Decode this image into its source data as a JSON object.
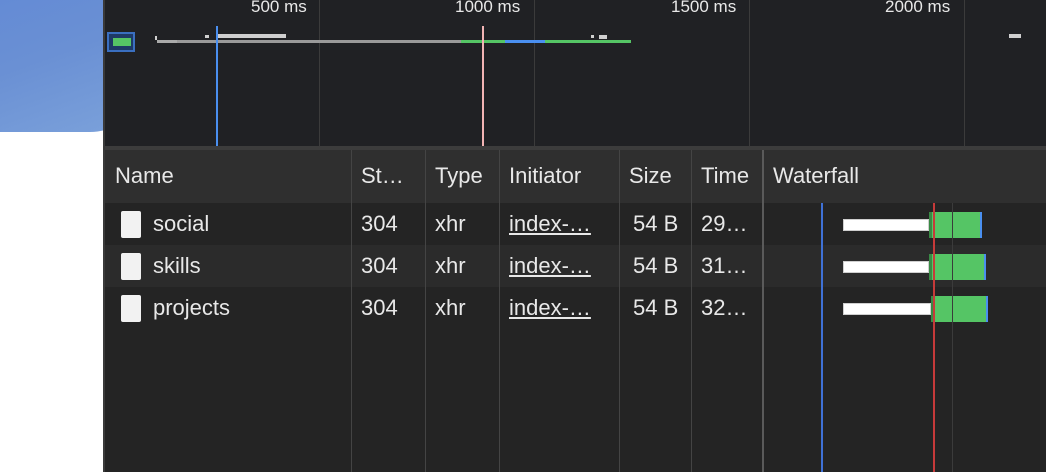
{
  "overview": {
    "ticks": [
      "500 ms",
      "1000 ms",
      "1500 ms",
      "2000 ms"
    ]
  },
  "table": {
    "headers": {
      "name": "Name",
      "status": "St…",
      "type": "Type",
      "initiator": "Initiator",
      "size": "Size",
      "time": "Time",
      "waterfall": "Waterfall"
    },
    "rows": [
      {
        "name": "social",
        "status": "304",
        "type": "xhr",
        "initiator": "index-…",
        "size": "54 B",
        "time": "29…"
      },
      {
        "name": "skills",
        "status": "304",
        "type": "xhr",
        "initiator": "index-…",
        "size": "54 B",
        "time": "31…"
      },
      {
        "name": "projects",
        "status": "304",
        "type": "xhr",
        "initiator": "index-…",
        "size": "54 B",
        "time": "32…"
      }
    ]
  },
  "colors": {
    "accent_blue": "#4a8ff0",
    "load_red": "#c63a3a",
    "download_green": "#55c565"
  },
  "icons": {
    "row_icon": "document-icon"
  }
}
